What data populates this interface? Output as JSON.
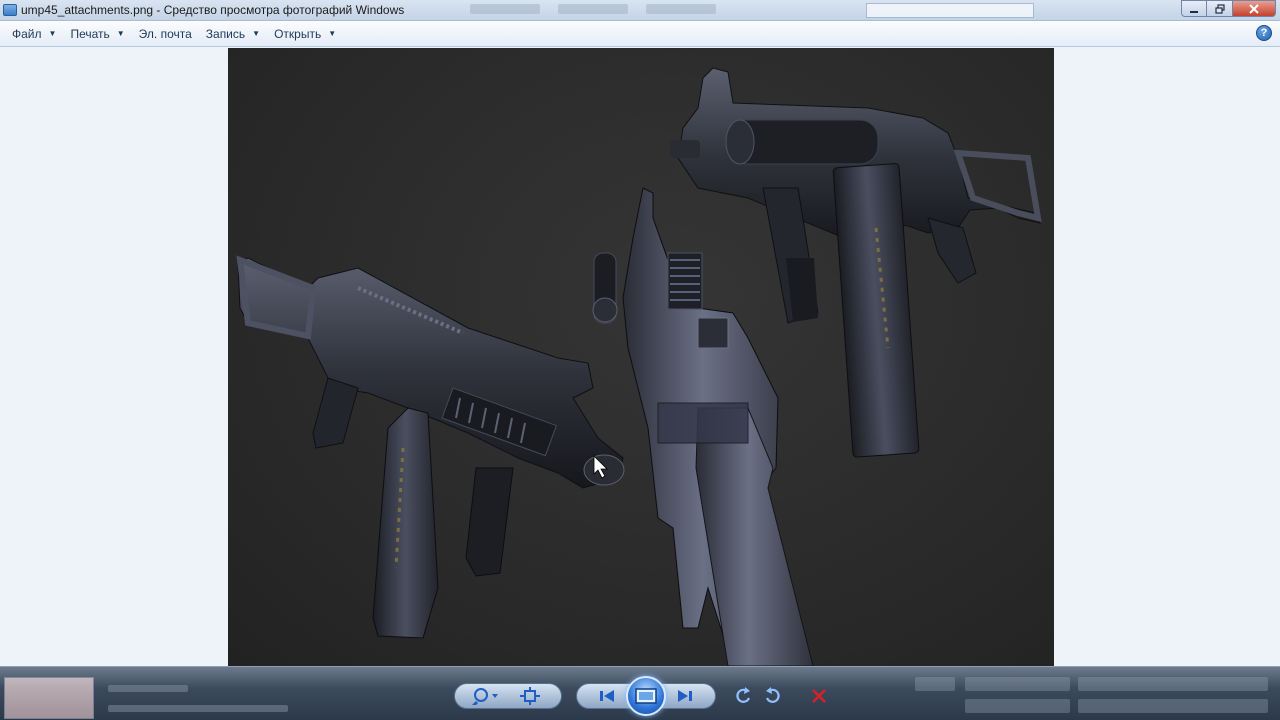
{
  "window": {
    "title": "ump45_attachments.png - Средство просмотра фотографий Windows"
  },
  "menu": {
    "items": [
      {
        "label": "Файл",
        "has_dropdown": true
      },
      {
        "label": "Печать",
        "has_dropdown": true
      },
      {
        "label": "Эл. почта",
        "has_dropdown": false
      },
      {
        "label": "Запись",
        "has_dropdown": true
      },
      {
        "label": "Открыть",
        "has_dropdown": true
      }
    ],
    "help_icon": "help-icon"
  },
  "viewer": {
    "image_subject": "three-ump45-submachine-guns-with-attachments",
    "background_color": "#2b2b2b"
  },
  "controls": {
    "buttons": [
      {
        "name": "zoom-button",
        "icon": "magnifier-icon"
      },
      {
        "name": "actual-size-button",
        "icon": "fit-window-icon"
      },
      {
        "name": "previous-button",
        "icon": "previous-icon"
      },
      {
        "name": "slideshow-button",
        "icon": "slideshow-icon"
      },
      {
        "name": "next-button",
        "icon": "next-icon"
      },
      {
        "name": "rotate-left-button",
        "icon": "rotate-ccw-icon"
      },
      {
        "name": "rotate-right-button",
        "icon": "rotate-cw-icon"
      },
      {
        "name": "delete-button",
        "icon": "delete-x-icon"
      }
    ],
    "accent_color": "#2d74d6",
    "delete_color": "#d8202b"
  }
}
